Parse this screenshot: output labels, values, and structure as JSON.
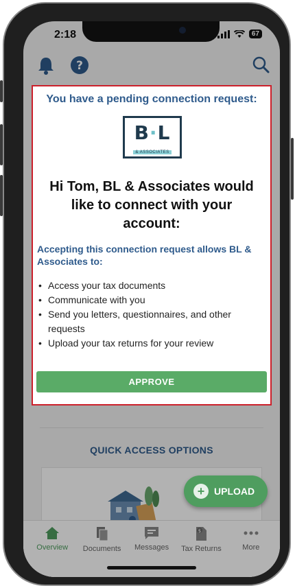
{
  "status_bar": {
    "time": "2:18",
    "battery": "67"
  },
  "app_bar": {
    "icons": [
      "bell-icon",
      "help-icon",
      "search-icon"
    ]
  },
  "modal": {
    "title": "You have a pending connection request:",
    "logo_text_b": "B",
    "logo_text_dot": "·",
    "logo_text_l": "L",
    "logo_sub": "& ASSOCIATES",
    "heading": "Hi Tom, BL & Associates would like to connect with your account:",
    "subheading": "Accepting this connection request allows BL & Associates to:",
    "bullets": [
      "Access your tax documents",
      "Communicate with you",
      "Send you letters, questionnaires, and other requests",
      "Upload your tax returns for your review"
    ],
    "approve_label": "APPROVE"
  },
  "quick_access": {
    "title": "QUICK ACCESS OPTIONS"
  },
  "upload_button": {
    "label": "UPLOAD"
  },
  "tabs": [
    {
      "label": "Overview",
      "icon": "home-icon",
      "active": true
    },
    {
      "label": "Documents",
      "icon": "documents-icon",
      "active": false
    },
    {
      "label": "Messages",
      "icon": "messages-icon",
      "active": false
    },
    {
      "label": "Tax Returns",
      "icon": "tax-returns-icon",
      "active": false
    },
    {
      "label": "More",
      "icon": "more-icon",
      "active": false
    }
  ],
  "colors": {
    "accent_green": "#5aab67",
    "title_blue": "#2f5b8c",
    "highlight_border": "#cc1f2a"
  }
}
